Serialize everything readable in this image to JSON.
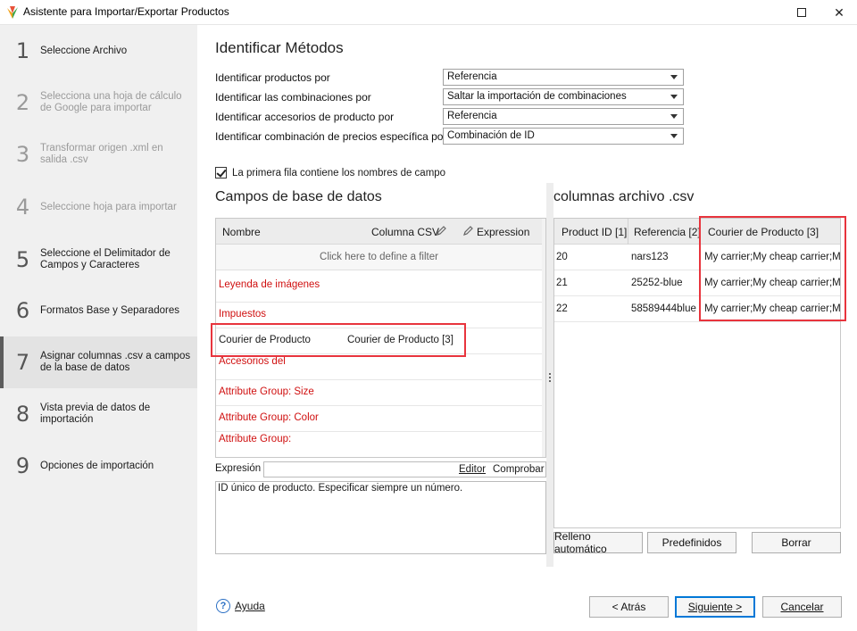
{
  "window": {
    "title": "Asistente para Importar/Exportar Productos"
  },
  "steps": [
    {
      "num": "1",
      "label": "Seleccione Archivo",
      "state": "normal"
    },
    {
      "num": "2",
      "label": "Selecciona una hoja de cálculo de Google para importar",
      "state": "disabled"
    },
    {
      "num": "3",
      "label": "Transformar origen .xml en salida .csv",
      "state": "disabled"
    },
    {
      "num": "4",
      "label": "Seleccione hoja para importar",
      "state": "disabled"
    },
    {
      "num": "5",
      "label": "Seleccione el Delimitador de Campos y Caracteres",
      "state": "normal"
    },
    {
      "num": "6",
      "label": "Formatos Base y Separadores",
      "state": "normal"
    },
    {
      "num": "7",
      "label": "Asignar columnas .csv a campos de la base de datos",
      "state": "active"
    },
    {
      "num": "8",
      "label": "Vista previa de datos de importación",
      "state": "normal"
    },
    {
      "num": "9",
      "label": "Opciones de importación",
      "state": "normal"
    }
  ],
  "identify": {
    "title": "Identificar Métodos",
    "rows": [
      {
        "label": "Identificar productos por",
        "value": "Referencia"
      },
      {
        "label": "Identificar las combinaciones por",
        "value": "Saltar la importación de combinaciones"
      },
      {
        "label": "Identificar accesorios de producto por",
        "value": "Referencia"
      },
      {
        "label": "Identificar combinación de precios específica por",
        "value": "Combinación de ID"
      }
    ],
    "first_row_checkbox": "La primera fila contiene los nombres de campo"
  },
  "db_fields": {
    "title": "Campos de base de datos",
    "col_name": "Nombre",
    "col_csv": "Columna CSV",
    "col_expression": "Expression",
    "filter_hint": "Click here to define a filter",
    "rows": [
      {
        "name": "Leyenda de imágenes",
        "csv": "",
        "required": true
      },
      {
        "name": "Impuestos",
        "csv": "",
        "required": true
      },
      {
        "name": "Courier de Producto",
        "csv": "Courier de Producto [3]",
        "required": false
      },
      {
        "name": "Accesorios del",
        "csv": "",
        "required": true
      },
      {
        "name": "Attribute Group: Size",
        "csv": "",
        "required": true
      },
      {
        "name": "Attribute Group: Color",
        "csv": "",
        "required": true
      },
      {
        "name": "Attribute Group:",
        "csv": "",
        "required": true
      }
    ]
  },
  "expression": {
    "label": "Expresión",
    "editor": "Editor",
    "check": "Comprobar",
    "description": "ID único de producto. Especificar siempre un número."
  },
  "csv": {
    "title": "columnas archivo .csv",
    "headers": [
      "Product ID [1]",
      "Referencia [2]",
      "Courier de Producto [3]"
    ],
    "rows": [
      [
        "20",
        "nars123",
        "My carrier;My cheap carrier;My"
      ],
      [
        "21",
        "25252-blue",
        "My carrier;My cheap carrier;My"
      ],
      [
        "22",
        "58589444blue",
        "My carrier;My cheap carrier;My"
      ]
    ],
    "buttons": {
      "auto": "Relleno automático",
      "defaults": "Predefinidos",
      "clear": "Borrar"
    }
  },
  "footer": {
    "help": "Ayuda",
    "back": "< Atrás",
    "next": "Siguiente >",
    "cancel": "Cancelar"
  },
  "colors": {
    "highlight": "#e8343d",
    "required_field": "#d01010",
    "accent": "#0078d7"
  }
}
